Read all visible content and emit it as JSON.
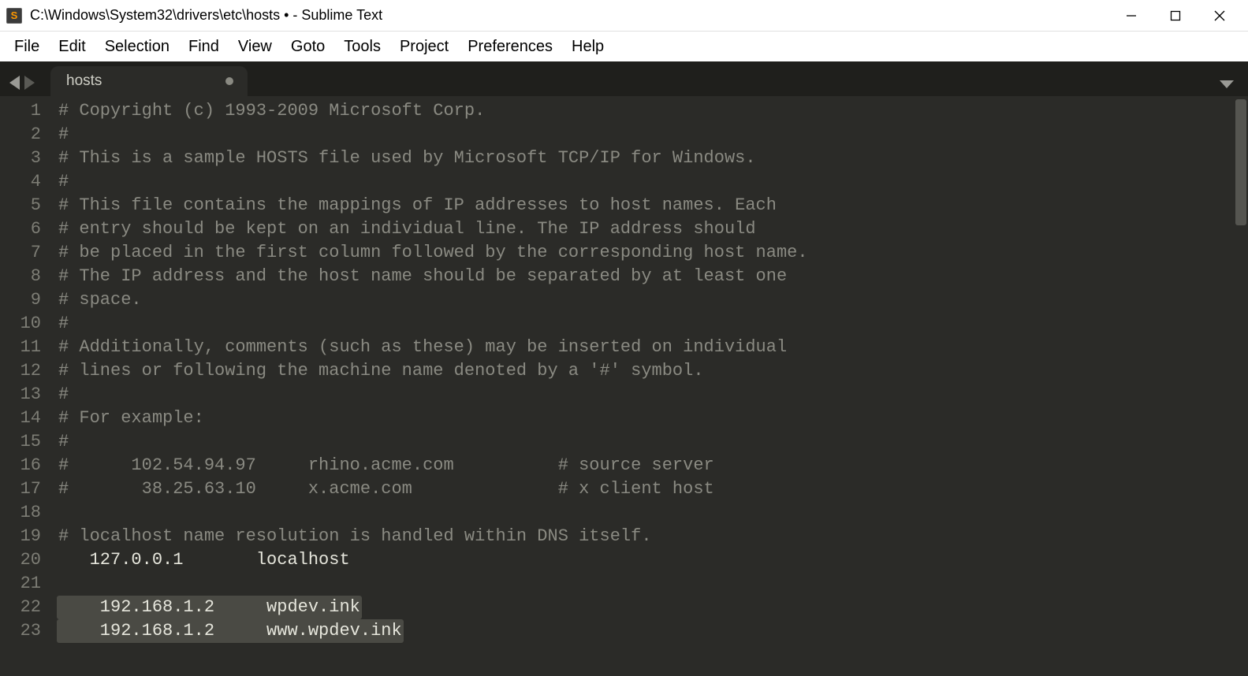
{
  "window": {
    "title": "C:\\Windows\\System32\\drivers\\etc\\hosts • - Sublime Text",
    "app_icon_letter": "S"
  },
  "menubar": [
    "File",
    "Edit",
    "Selection",
    "Find",
    "View",
    "Goto",
    "Tools",
    "Project",
    "Preferences",
    "Help"
  ],
  "tabs": [
    {
      "label": "hosts",
      "dirty": true
    }
  ],
  "editor": {
    "lines": [
      {
        "n": 1,
        "type": "comment",
        "text": "# Copyright (c) 1993-2009 Microsoft Corp."
      },
      {
        "n": 2,
        "type": "comment",
        "text": "#"
      },
      {
        "n": 3,
        "type": "comment",
        "text": "# This is a sample HOSTS file used by Microsoft TCP/IP for Windows."
      },
      {
        "n": 4,
        "type": "comment",
        "text": "#"
      },
      {
        "n": 5,
        "type": "comment",
        "text": "# This file contains the mappings of IP addresses to host names. Each"
      },
      {
        "n": 6,
        "type": "comment",
        "text": "# entry should be kept on an individual line. The IP address should"
      },
      {
        "n": 7,
        "type": "comment",
        "text": "# be placed in the first column followed by the corresponding host name."
      },
      {
        "n": 8,
        "type": "comment",
        "text": "# The IP address and the host name should be separated by at least one"
      },
      {
        "n": 9,
        "type": "comment",
        "text": "# space."
      },
      {
        "n": 10,
        "type": "comment",
        "text": "#"
      },
      {
        "n": 11,
        "type": "comment",
        "text": "# Additionally, comments (such as these) may be inserted on individual"
      },
      {
        "n": 12,
        "type": "comment",
        "text": "# lines or following the machine name denoted by a '#' symbol."
      },
      {
        "n": 13,
        "type": "comment",
        "text": "#"
      },
      {
        "n": 14,
        "type": "comment",
        "text": "# For example:"
      },
      {
        "n": 15,
        "type": "comment",
        "text": "#"
      },
      {
        "n": 16,
        "type": "comment",
        "text": "#      102.54.94.97     rhino.acme.com          # source server"
      },
      {
        "n": 17,
        "type": "comment",
        "text": "#       38.25.63.10     x.acme.com              # x client host"
      },
      {
        "n": 18,
        "type": "plain",
        "text": ""
      },
      {
        "n": 19,
        "type": "comment",
        "text": "# localhost name resolution is handled within DNS itself."
      },
      {
        "n": 20,
        "type": "plain",
        "text": "   127.0.0.1       localhost"
      },
      {
        "n": 21,
        "type": "plain",
        "text": ""
      },
      {
        "n": 22,
        "type": "sel",
        "text": "    192.168.1.2     wpdev.ink"
      },
      {
        "n": 23,
        "type": "sel",
        "text": "    192.168.1.2     www.wpdev.ink"
      }
    ]
  }
}
